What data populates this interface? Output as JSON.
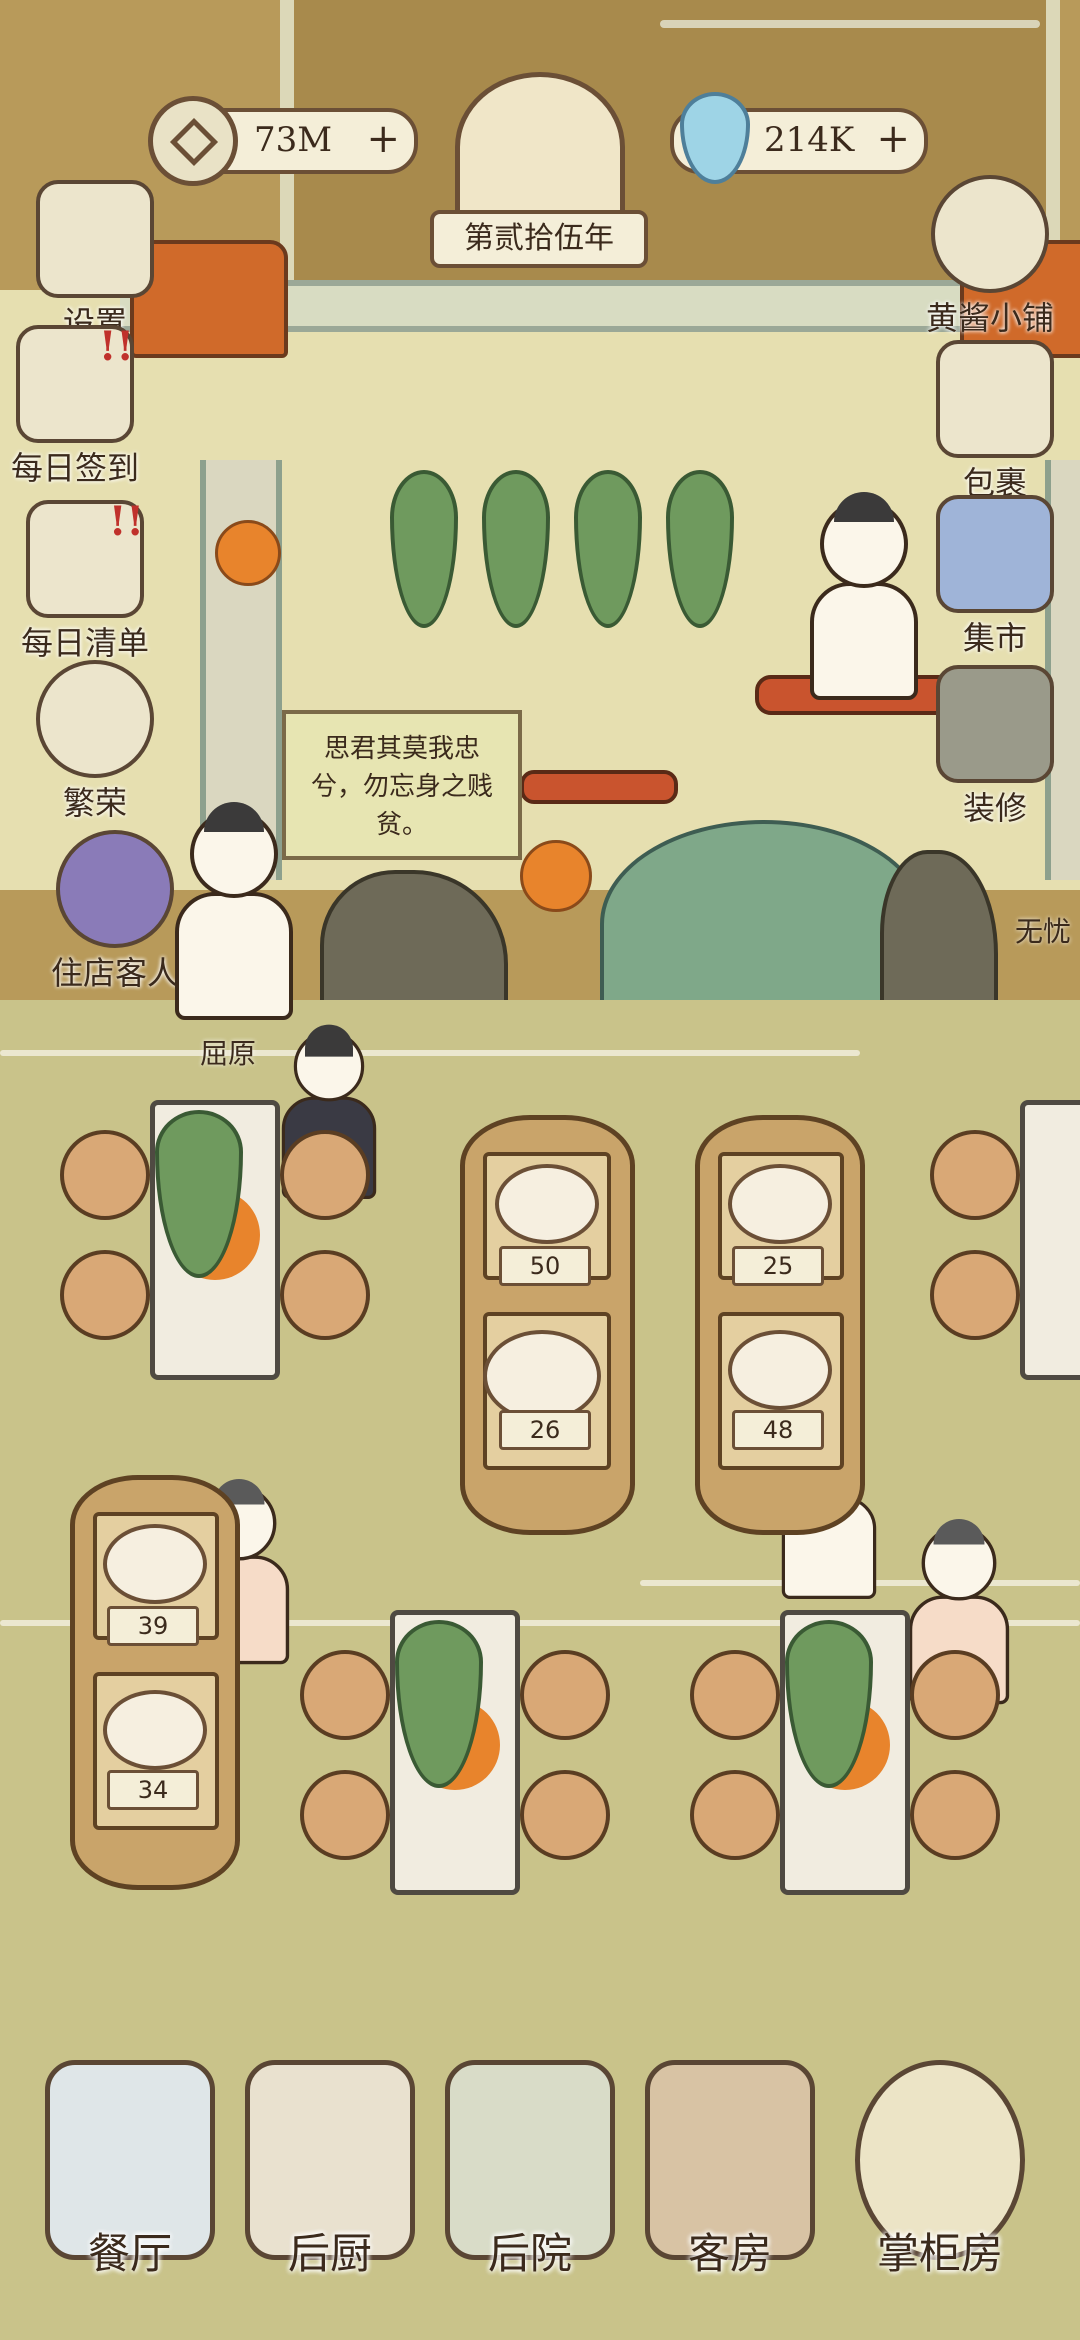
{
  "top_bar": {
    "coins": {
      "value": "73M",
      "plus": "+",
      "icon": "coin-icon"
    },
    "year": {
      "label": "第贰拾伍年"
    },
    "water": {
      "value": "214K",
      "plus": "+",
      "icon": "water-drop-icon"
    }
  },
  "left_menu": [
    {
      "label": "设置",
      "icon": "settings-icon",
      "alert": ""
    },
    {
      "label": "每日签到",
      "icon": "daily-signin-icon",
      "alert": "!!"
    },
    {
      "label": "每日清单",
      "icon": "daily-list-icon",
      "alert": "!!"
    },
    {
      "label": "繁荣",
      "icon": "prosperity-icon",
      "alert": ""
    },
    {
      "label": "住店客人",
      "icon": "guests-icon",
      "alert": ""
    }
  ],
  "right_menu": [
    {
      "label": "黄酱小铺",
      "icon": "shop-icon"
    },
    {
      "label": "包裹",
      "icon": "parcel-icon"
    },
    {
      "label": "集市",
      "icon": "market-icon"
    },
    {
      "label": "装修",
      "icon": "decorate-icon"
    }
  ],
  "scene": {
    "speech": "思君其莫我忠兮，勿忘身之贱贫。",
    "npc_name": "屈原",
    "right_edge_label": "无忧"
  },
  "menu_rafts": {
    "raft_a": {
      "prices": [
        "50",
        "26"
      ]
    },
    "raft_b": {
      "prices": [
        "25",
        "48"
      ]
    },
    "raft_c": {
      "prices": [
        "39",
        "34"
      ]
    }
  },
  "bottom_nav": [
    {
      "label": "餐厅",
      "icon": "restaurant-icon"
    },
    {
      "label": "后厨",
      "icon": "kitchen-icon"
    },
    {
      "label": "后院",
      "icon": "backyard-icon"
    },
    {
      "label": "客房",
      "icon": "guest-room-icon"
    },
    {
      "label": "掌柜房",
      "icon": "manager-room-icon"
    }
  ],
  "colors": {
    "floor": "#c9c38a",
    "wall": "#e6dfb0",
    "accent_orange": "#e8842c",
    "leaf_green": "#6f9a5e",
    "alert_red": "#c0312b"
  }
}
